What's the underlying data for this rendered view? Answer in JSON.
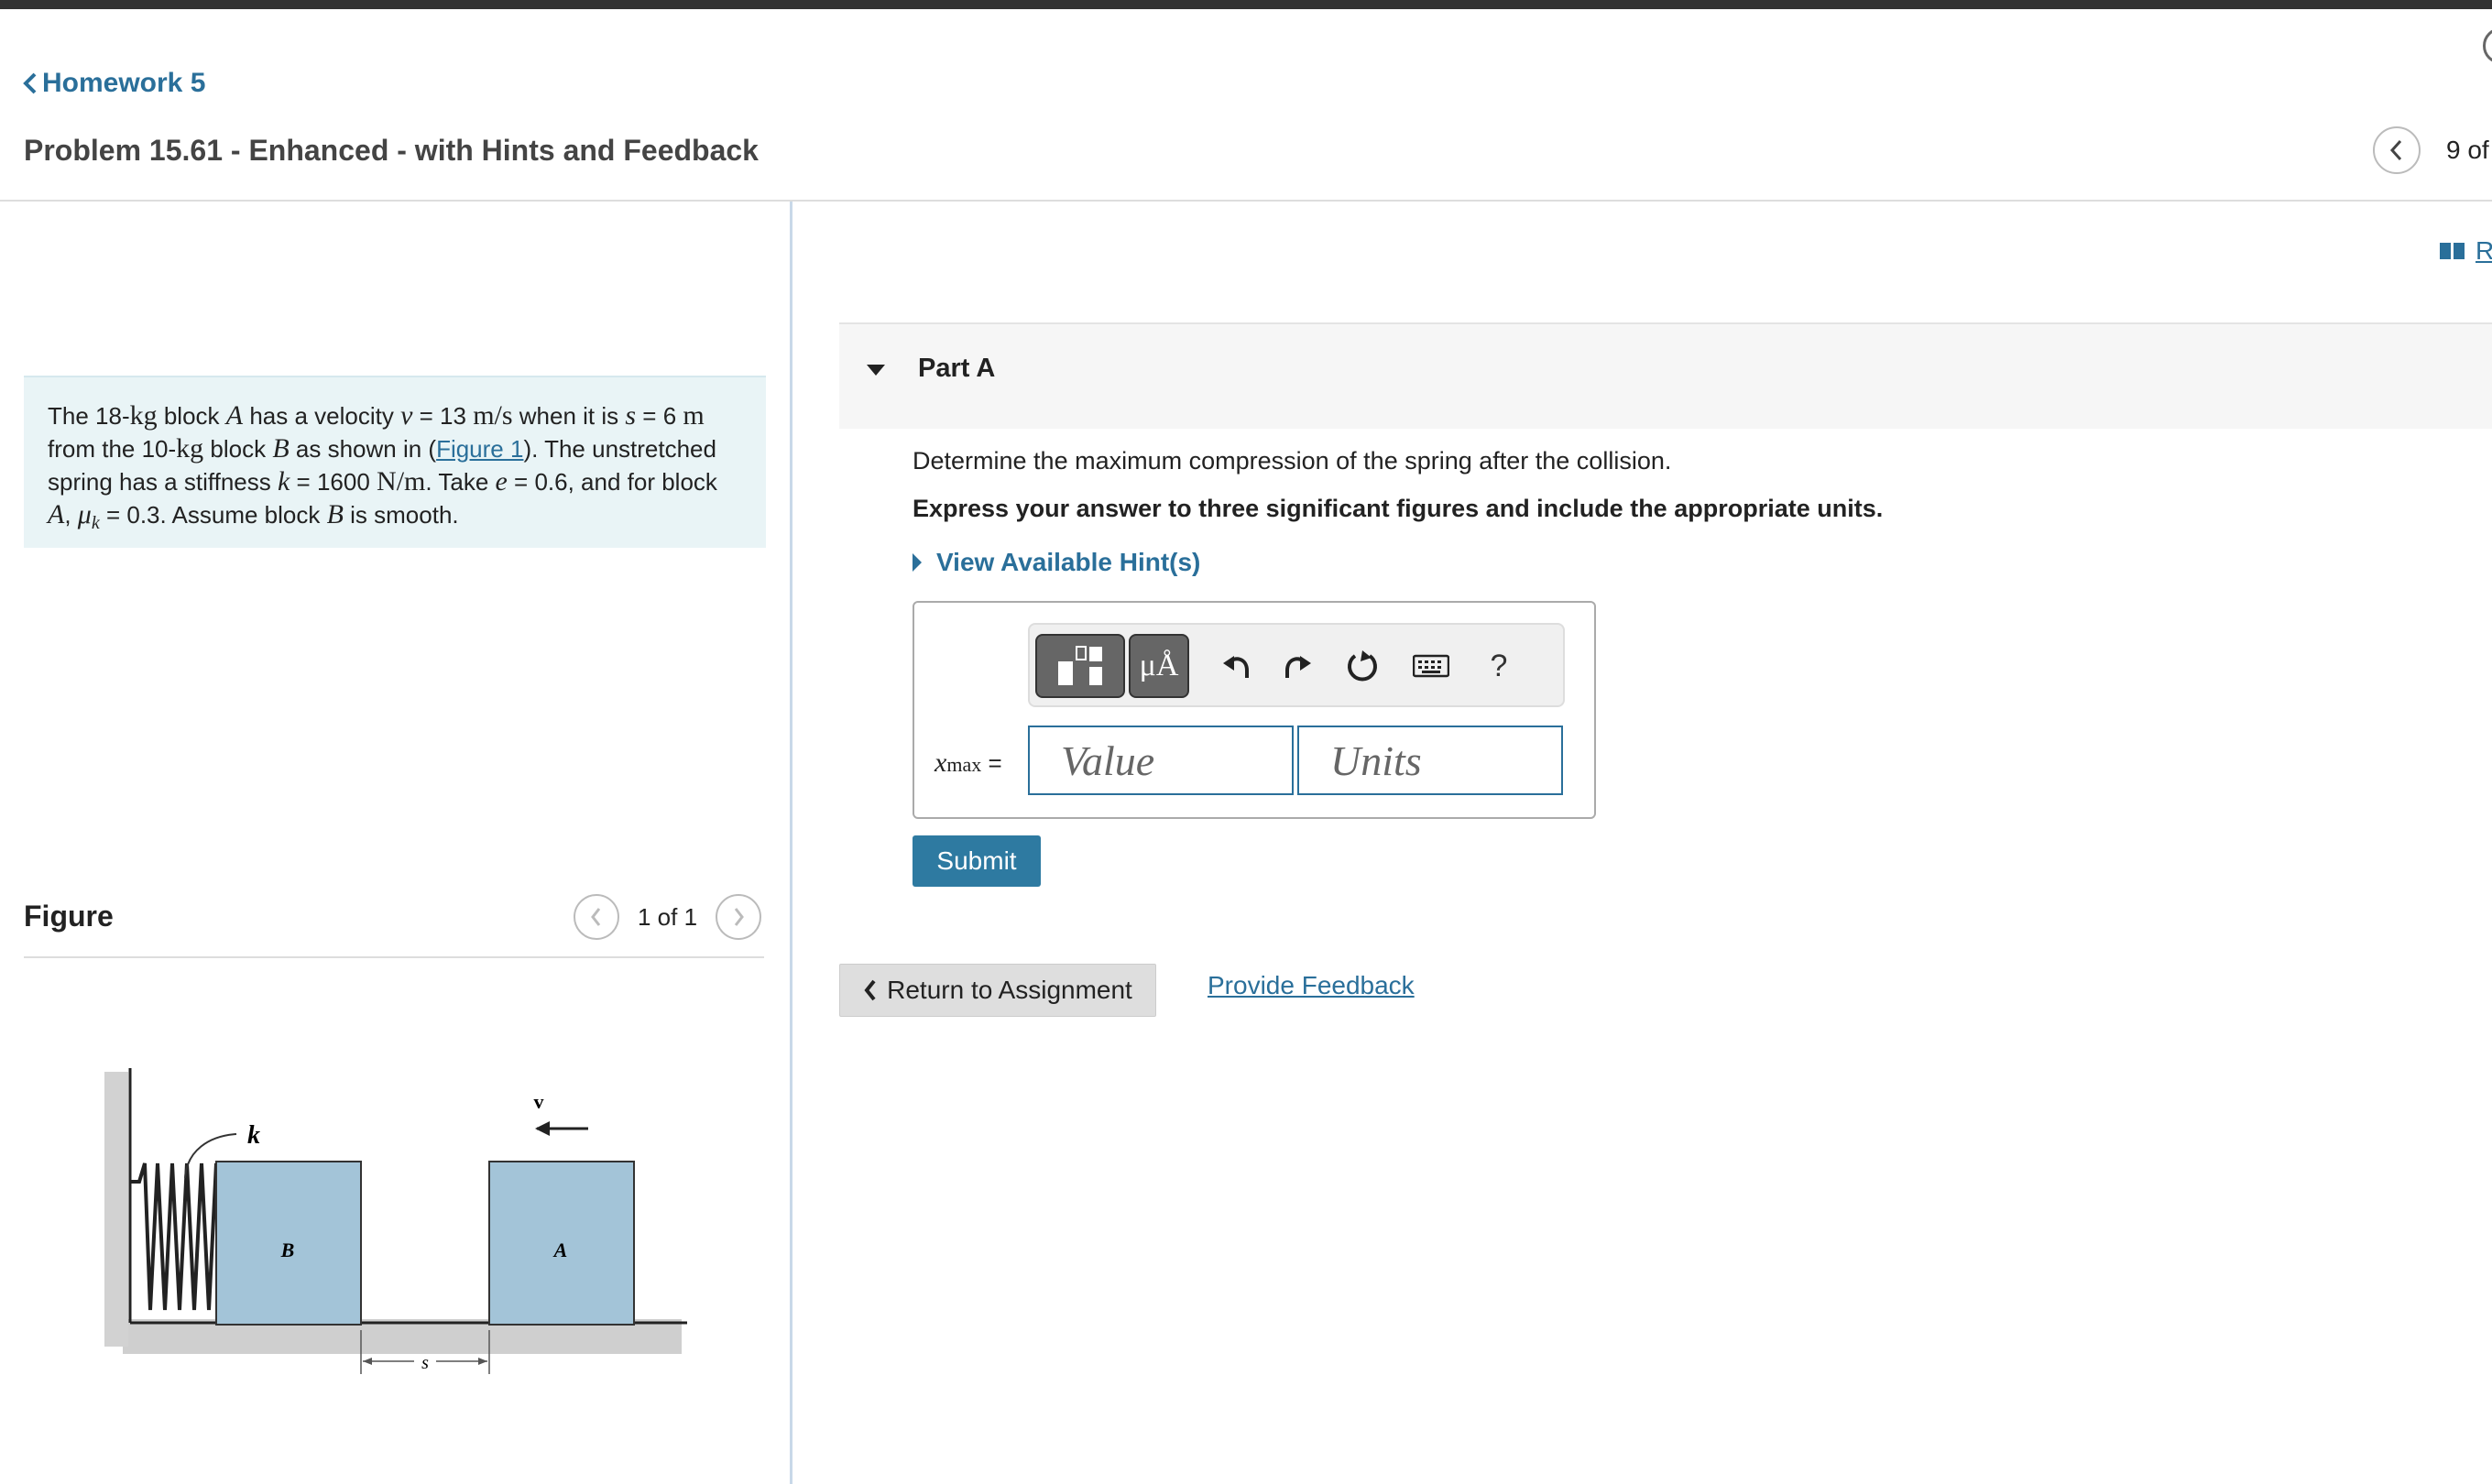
{
  "header": {
    "back_label": "Homework 5",
    "problem_title": "Problem 15.61 - Enhanced - with Hints and Feedback",
    "page_count": "9 of",
    "resources_label": "R"
  },
  "problem": {
    "t1": "The 18-",
    "kg1": "kg",
    "t2": " block ",
    "A1": "A",
    "t3": " has a velocity ",
    "v": "v",
    "t4": " = 13 ",
    "ms": "m/s",
    "t5": " when it is ",
    "s": "s",
    "t6": " = 6 ",
    "m1": "m",
    "t7": " from the 10-",
    "kg2": "kg",
    "t8": " block ",
    "B1": "B",
    "t9": " as shown in (",
    "figure_link": "Figure 1",
    "t10": "). The unstretched spring has a stiffness ",
    "k": "k",
    "t11": " = 1600 ",
    "Nm": "N/m",
    "t12": ". Take ",
    "e": "e",
    "t13": " = 0.6, and for block ",
    "A2": "A",
    "t14": ", ",
    "mu": "μ",
    "muk": "k",
    "t15": " = 0.3. Assume block ",
    "B2": "B",
    "t16": " is smooth."
  },
  "figure": {
    "label": "Figure",
    "count": "1 of 1",
    "labels": {
      "k": "k",
      "v": "v",
      "B": "B",
      "A": "A",
      "s": "s"
    },
    "colors": {
      "block": "#a3c4d8",
      "ground": "#c8c8c8"
    }
  },
  "part_a": {
    "title": "Part A",
    "question": "Determine the maximum compression of the spring after the collision.",
    "instructions": "Express your answer to three significant figures and include the appropriate units.",
    "hints_label": "View Available Hint(s)",
    "toolbar": {
      "mu_label": "μÅ",
      "help_label": "?"
    },
    "answer_var": "x",
    "answer_sub": "max",
    "answer_eq": " =",
    "value_placeholder": "Value",
    "units_placeholder": "Units",
    "submit_label": "Submit"
  },
  "footer": {
    "return_label": "Return to Assignment",
    "feedback_label": "Provide Feedback"
  },
  "colors": {
    "accent": "#2a6f9a",
    "submit": "#2e7aa1",
    "problem_bg": "#e9f4f6"
  }
}
